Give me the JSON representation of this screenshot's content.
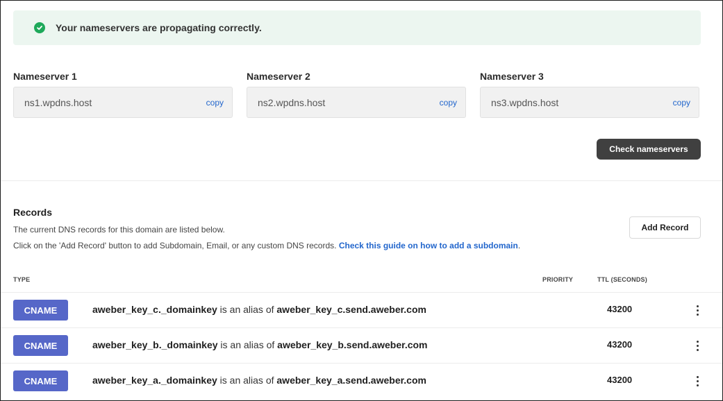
{
  "banner": {
    "message": "Your nameservers are propagating correctly.",
    "icon": "check-circle-icon",
    "accent": "#1ea95a"
  },
  "nameservers": [
    {
      "label": "Nameserver 1",
      "value": "ns1.wpdns.host",
      "copy": "copy"
    },
    {
      "label": "Nameserver 2",
      "value": "ns2.wpdns.host",
      "copy": "copy"
    },
    {
      "label": "Nameserver 3",
      "value": "ns3.wpdns.host",
      "copy": "copy"
    }
  ],
  "check_button": "Check nameservers",
  "records": {
    "title": "Records",
    "desc1": "The current DNS records for this domain are listed below.",
    "desc2": "Click on the 'Add Record' button to add Subdomain, Email, or any custom DNS records.",
    "guide_link": "Check this guide on how to add a subdomain",
    "guide_suffix": ".",
    "add_button": "Add Record",
    "columns": {
      "type": "TYPE",
      "priority": "PRIORITY",
      "ttl": "TTL (SECONDS)"
    },
    "rows": [
      {
        "type": "CNAME",
        "name": "aweber_key_c._domainkey",
        "alias_text": " is an alias of ",
        "target": "aweber_key_c.send.aweber.com",
        "ttl": "43200"
      },
      {
        "type": "CNAME",
        "name": "aweber_key_b._domainkey",
        "alias_text": " is an alias of ",
        "target": "aweber_key_b.send.aweber.com",
        "ttl": "43200"
      },
      {
        "type": "CNAME",
        "name": "aweber_key_a._domainkey",
        "alias_text": " is an alias of ",
        "target": "aweber_key_a.send.aweber.com",
        "ttl": "43200"
      }
    ]
  },
  "colors": {
    "badge": "#5667c8",
    "link": "#2266cc",
    "dark_button": "#404040",
    "banner_bg": "#ecf6f0"
  }
}
